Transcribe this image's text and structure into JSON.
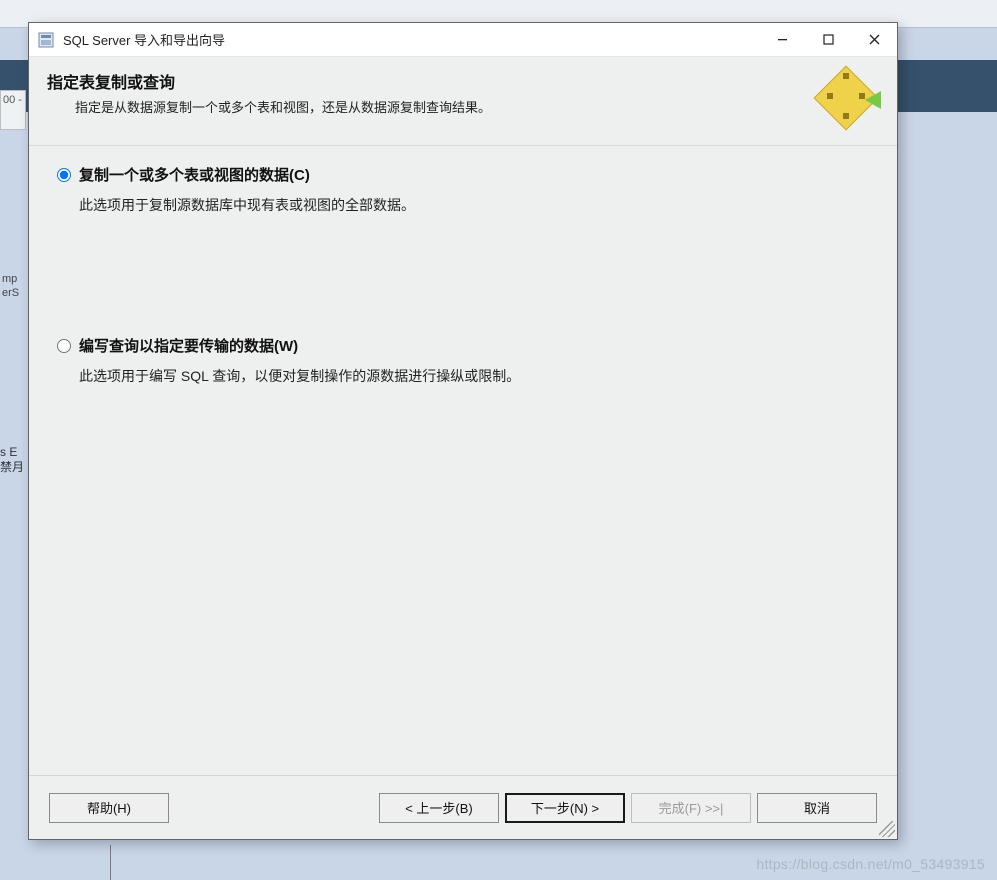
{
  "bg": {
    "left1_line1": "00 -",
    "left2": "mp\nerS",
    "left3_line1": "s E",
    "left3_line2": "禁月"
  },
  "window": {
    "title": "SQL Server 导入和导出向导"
  },
  "header": {
    "title": "指定表复制或查询",
    "subtitle": "指定是从数据源复制一个或多个表和视图，还是从数据源复制查询结果。"
  },
  "options": {
    "copy": {
      "label": "复制一个或多个表或视图的数据(C)",
      "desc": "此选项用于复制源数据库中现有表或视图的全部数据。",
      "checked": true
    },
    "query": {
      "label": "编写查询以指定要传输的数据(W)",
      "desc": "此选项用于编写 SQL 查询，以便对复制操作的源数据进行操纵或限制。",
      "checked": false
    }
  },
  "buttons": {
    "help": "帮助(H)",
    "back": "< 上一步(B)",
    "next": "下一步(N) >",
    "finish": "完成(F) >>|",
    "cancel": "取消"
  },
  "watermark": "https://blog.csdn.net/m0_53493915"
}
